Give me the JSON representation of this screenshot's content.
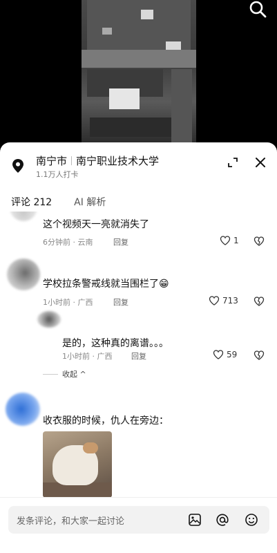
{
  "location": {
    "city": "南宁市",
    "place": "南宁职业技术大学",
    "checkins": "1.1万人打卡"
  },
  "tabs": [
    {
      "label": "评论 212",
      "active": true
    },
    {
      "label": "AI 解析",
      "active": false
    }
  ],
  "comments": [
    {
      "text": "这个视频天一亮就消失了",
      "time": "6分钟前 · 云南",
      "reply_label": "回复",
      "likes": "1"
    },
    {
      "text": "学校拉条警戒线就当围栏了😁",
      "time": "1小时前 · 广西",
      "reply_label": "回复",
      "likes": "713"
    },
    {
      "text": "是的，这种真的离谱。。。",
      "time": "1小时前 · 广西",
      "reply_label": "回复",
      "likes": "59"
    },
    {
      "text": "收衣服的时候，仇人在旁边："
    }
  ],
  "collapse_label": "收起",
  "input": {
    "placeholder": "发条评论，和大家一起讨论"
  },
  "icons": {
    "search": "search-icon",
    "pin": "location-pin-icon",
    "expand": "expand-icon",
    "close": "close-icon",
    "heart": "heart-icon",
    "dislike": "broken-heart-icon",
    "image": "image-icon",
    "mention": "at-icon",
    "emoji": "emoji-icon"
  }
}
